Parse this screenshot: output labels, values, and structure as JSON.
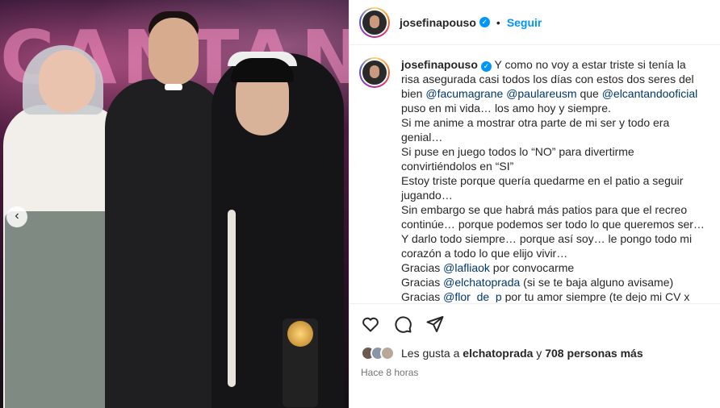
{
  "post": {
    "author": "josefinapouso",
    "follow_label": "Seguir",
    "separator": "•",
    "verified_icon": "verified-badge-icon",
    "carousel_prev_glyph": "‹",
    "stage_sign": "CANTAND"
  },
  "caption": {
    "author": "josefinapouso",
    "line1": " Y como no voy a estar triste si tenía la risa asegurada casi todos los días con estos dos seres del bien ",
    "mention1": "@facumagrane",
    "mention2": "@paulareusm",
    "line1b": " que ",
    "mention3": "@elcantandooficial",
    "line1c": " puso en mi vida… los amo hoy y siempre.",
    "p2": "Si me anime a mostrar otra parte de mi ser y todo era genial…",
    "p3": "Si puse en juego todos lo “NO” para divertirme convirtiéndolos en “SI”",
    "p4": "Estoy triste porque quería quedarme en el patio a seguir jugando…",
    "p5": "Sin embargo se que habrá más patios para que el recreo continúe… porque podemos ser todo lo que queremos ser…",
    "p6": "Y darlo todo siempre… porque así soy… le pongo todo mi corazón a todo lo que elijo vivir…",
    "g1_prefix": "Gracias ",
    "g1_mention": "@lafliaok",
    "g1_suffix": " por convocarme",
    "g2_prefix": "Gracias ",
    "g2_mention": "@elchatoprada",
    "g2_suffix": " (si se te baja alguno avisame)",
    "g3_prefix": "Gracias ",
    "g3_mention": "@flor_de_p",
    "g3_suffix": " por tu amor siempre (te dejo mi CV x las dudas 😉)"
  },
  "actions": {
    "like_icon": "heart-icon",
    "comment_icon": "comment-icon",
    "share_icon": "share-icon"
  },
  "likes": {
    "prefix": "Les gusta a ",
    "first_liker": "elchatoprada",
    "middle": " y ",
    "others": "708 personas más"
  },
  "timestamp": "Hace 8 horas",
  "colors": {
    "link_blue": "#0095f6",
    "mention": "#00376b",
    "text": "#262626",
    "muted": "#737373"
  }
}
